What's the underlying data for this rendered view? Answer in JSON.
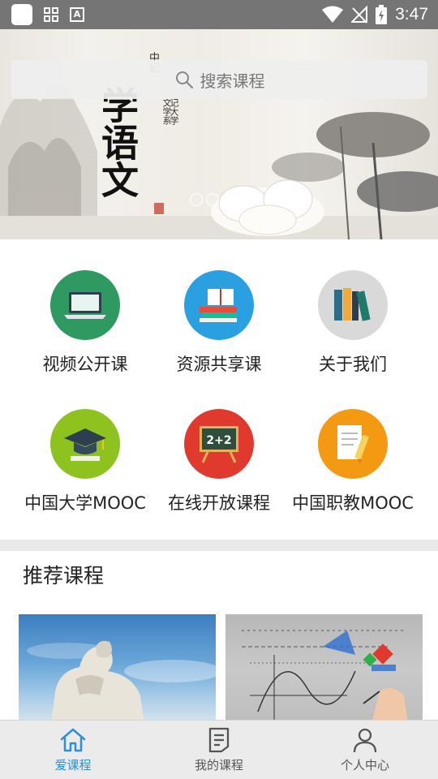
{
  "status_bar": {
    "time": "3:47"
  },
  "banner": {
    "calligraphy": "学语文",
    "small_text_1": "中纪",
    "small_text_2": "文学系",
    "small_text_3": "记大学",
    "carousel_pages": 4,
    "carousel_active_index": 2
  },
  "search": {
    "placeholder": "搜索课程"
  },
  "categories": [
    {
      "label": "视频公开课",
      "color": "#2e9a62",
      "icon": "laptop-icon"
    },
    {
      "label": "资源共享课",
      "color": "#2aa0e0",
      "icon": "books-stack-icon"
    },
    {
      "label": "关于我们",
      "color": "#d9d9d9",
      "icon": "bookshelf-icon"
    },
    {
      "label": "中国大学MOOC",
      "color": "#8dc21f",
      "icon": "graduation-cap-icon"
    },
    {
      "label": "在线开放课程",
      "color": "#e0392d",
      "icon": "chalkboard-icon"
    },
    {
      "label": "中国职教MOOC",
      "color": "#f39a12",
      "icon": "notes-pencil-icon"
    }
  ],
  "recommended": {
    "title": "推荐课程",
    "items": [
      {
        "image": "statue-thinker-image"
      },
      {
        "image": "math-formulas-image"
      }
    ]
  },
  "tabbar": {
    "tabs": [
      {
        "label": "爱课程",
        "icon": "home-icon",
        "active": true
      },
      {
        "label": "我的课程",
        "icon": "document-icon",
        "active": false
      },
      {
        "label": "个人中心",
        "icon": "person-icon",
        "active": false
      }
    ],
    "active_color": "#2b8fd9"
  }
}
